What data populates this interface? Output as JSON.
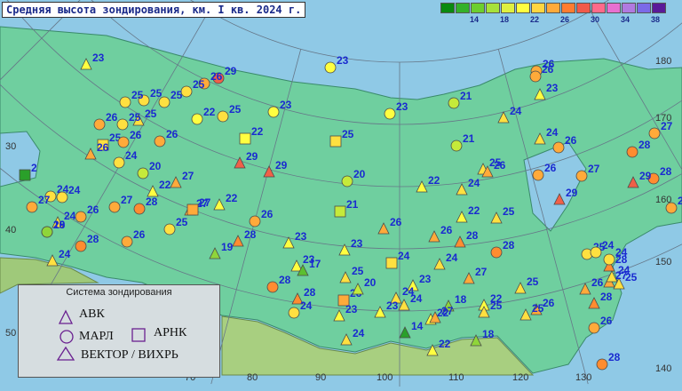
{
  "title": "Средняя высота зондирования, км. I кв. 2024 г.",
  "scale": {
    "colors": [
      "#0a8a10",
      "#33b12a",
      "#6ccf2f",
      "#a7e23a",
      "#dff040",
      "#ffff40",
      "#ffd640",
      "#ffaa3a",
      "#ff7c30",
      "#f05a4a",
      "#ff6a8a",
      "#e870d0",
      "#b07ae0",
      "#7b6ae8",
      "#5a1a99"
    ],
    "labels": [
      "14",
      "18",
      "22",
      "26",
      "30",
      "34",
      "38"
    ],
    "label_index": [
      1,
      3,
      5,
      7,
      9,
      11,
      13
    ]
  },
  "grid_labels": {
    "lat": [
      "50",
      "40",
      "30"
    ],
    "lon": [
      "70",
      "80",
      "90",
      "100",
      "110",
      "120",
      "130"
    ],
    "right": [
      "180",
      "170",
      "160",
      "150",
      "140"
    ]
  },
  "legend": {
    "title": "Система зондирования",
    "avk": "АВК",
    "marl": "МАРЛ",
    "arnk": "АРНК",
    "vektor": "ВЕКТОР / ВИХРЬ"
  },
  "stations": [
    {
      "s": "t",
      "v": "23"
    },
    {
      "s": "c",
      "v": "23"
    },
    {
      "s": "c",
      "v": "26"
    },
    {
      "s": "t",
      "v": "23"
    },
    {
      "s": "c",
      "v": "29"
    },
    {
      "s": "c",
      "v": "26"
    },
    {
      "s": "c",
      "v": "25"
    },
    {
      "s": "c",
      "v": "25"
    },
    {
      "s": "c",
      "v": "25"
    },
    {
      "s": "c",
      "v": "25"
    },
    {
      "s": "c",
      "v": "22"
    },
    {
      "s": "c",
      "v": "25"
    },
    {
      "s": "c",
      "v": "23"
    },
    {
      "s": "c",
      "v": "23"
    },
    {
      "s": "c",
      "v": "21"
    },
    {
      "s": "c",
      "v": "26"
    },
    {
      "s": "c",
      "v": "26"
    },
    {
      "s": "t",
      "v": "25"
    },
    {
      "s": "c",
      "v": "25"
    },
    {
      "s": "t",
      "v": "24"
    },
    {
      "s": "r",
      "v": "22"
    },
    {
      "s": "r",
      "v": "25"
    },
    {
      "s": "c",
      "v": "21"
    },
    {
      "s": "r",
      "v": "25"
    },
    {
      "s": "c",
      "v": "26"
    },
    {
      "s": "c",
      "v": "26"
    },
    {
      "s": "t",
      "v": "24"
    },
    {
      "s": "c",
      "v": "26"
    },
    {
      "s": "c",
      "v": "28"
    },
    {
      "s": "c",
      "v": "27"
    },
    {
      "s": "c",
      "v": "24"
    },
    {
      "s": "t",
      "v": "26"
    },
    {
      "s": "c",
      "v": "24"
    },
    {
      "s": "c",
      "v": "20"
    },
    {
      "s": "t",
      "v": "27"
    },
    {
      "s": "t",
      "v": "29"
    },
    {
      "s": "t",
      "v": "29"
    },
    {
      "s": "c",
      "v": "20"
    },
    {
      "s": "t",
      "v": "25"
    },
    {
      "s": "c",
      "v": "26"
    },
    {
      "s": "t",
      "v": "26"
    },
    {
      "s": "c",
      "v": "27"
    },
    {
      "s": "r",
      "v": "2"
    },
    {
      "s": "c",
      "v": "28"
    },
    {
      "s": "t",
      "v": "29"
    },
    {
      "s": "c",
      "v": "24"
    },
    {
      "s": "c",
      "v": "27"
    },
    {
      "s": "t",
      "v": "22"
    },
    {
      "s": "t",
      "v": "22"
    },
    {
      "s": "t",
      "v": "24"
    },
    {
      "s": "t",
      "v": "29"
    },
    {
      "s": "c",
      "v": "26"
    },
    {
      "s": "c",
      "v": "27"
    },
    {
      "s": "c",
      "v": "28"
    },
    {
      "s": "t",
      "v": "27"
    },
    {
      "s": "t",
      "v": "22"
    },
    {
      "s": "r",
      "v": "27"
    },
    {
      "s": "r",
      "v": "21"
    },
    {
      "s": "t",
      "v": "22"
    },
    {
      "s": "t",
      "v": "25"
    },
    {
      "s": "c",
      "v": "27"
    },
    {
      "s": "t",
      "v": "24"
    },
    {
      "s": "c",
      "v": "26"
    },
    {
      "s": "c",
      "v": "28"
    },
    {
      "s": "c",
      "v": "19"
    },
    {
      "s": "t",
      "v": "24"
    },
    {
      "s": "c",
      "v": "26"
    },
    {
      "s": "c",
      "v": "25"
    },
    {
      "s": "t",
      "v": "23"
    },
    {
      "s": "c",
      "v": "26"
    },
    {
      "s": "t",
      "v": "28"
    },
    {
      "s": "t",
      "v": "23"
    },
    {
      "s": "t",
      "v": "26"
    },
    {
      "s": "t",
      "v": "26"
    },
    {
      "s": "t",
      "v": "28"
    },
    {
      "s": "t",
      "v": "19"
    },
    {
      "s": "t",
      "v": "23"
    },
    {
      "s": "c",
      "v": "28"
    },
    {
      "s": "t",
      "v": "24"
    },
    {
      "s": "t",
      "v": "17"
    },
    {
      "s": "t",
      "v": "25"
    },
    {
      "s": "r",
      "v": "24"
    },
    {
      "s": "t",
      "v": "23"
    },
    {
      "s": "t",
      "v": "27"
    },
    {
      "s": "c",
      "v": "25"
    },
    {
      "s": "t",
      "v": "28"
    },
    {
      "s": "t",
      "v": "25"
    },
    {
      "s": "c",
      "v": "24"
    },
    {
      "s": "c",
      "v": "28"
    },
    {
      "s": "t",
      "v": "28"
    },
    {
      "s": "r",
      "v": "26"
    },
    {
      "s": "t",
      "v": "24"
    },
    {
      "s": "t",
      "v": "20"
    },
    {
      "s": "t",
      "v": "24"
    },
    {
      "s": "t",
      "v": "18"
    },
    {
      "s": "t",
      "v": "25"
    },
    {
      "s": "t",
      "v": "26"
    },
    {
      "s": "t",
      "v": "28"
    },
    {
      "s": "t",
      "v": "27"
    },
    {
      "s": "c",
      "v": "24"
    },
    {
      "s": "t",
      "v": "23"
    },
    {
      "s": "t",
      "v": "23"
    },
    {
      "s": "t",
      "v": "22"
    },
    {
      "s": "t",
      "v": "26"
    },
    {
      "s": "t",
      "v": "22"
    },
    {
      "s": "t",
      "v": "25"
    },
    {
      "s": "t",
      "v": "27"
    },
    {
      "s": "t",
      "v": "14"
    },
    {
      "s": "t",
      "v": "22"
    },
    {
      "s": "t",
      "v": "18"
    },
    {
      "s": "t",
      "v": "24"
    },
    {
      "s": "c",
      "v": "26"
    },
    {
      "s": "c",
      "v": "28"
    },
    {
      "s": "t",
      "v": "24"
    },
    {
      "s": "c",
      "v": "24"
    },
    {
      "s": "t",
      "v": "25"
    }
  ]
}
